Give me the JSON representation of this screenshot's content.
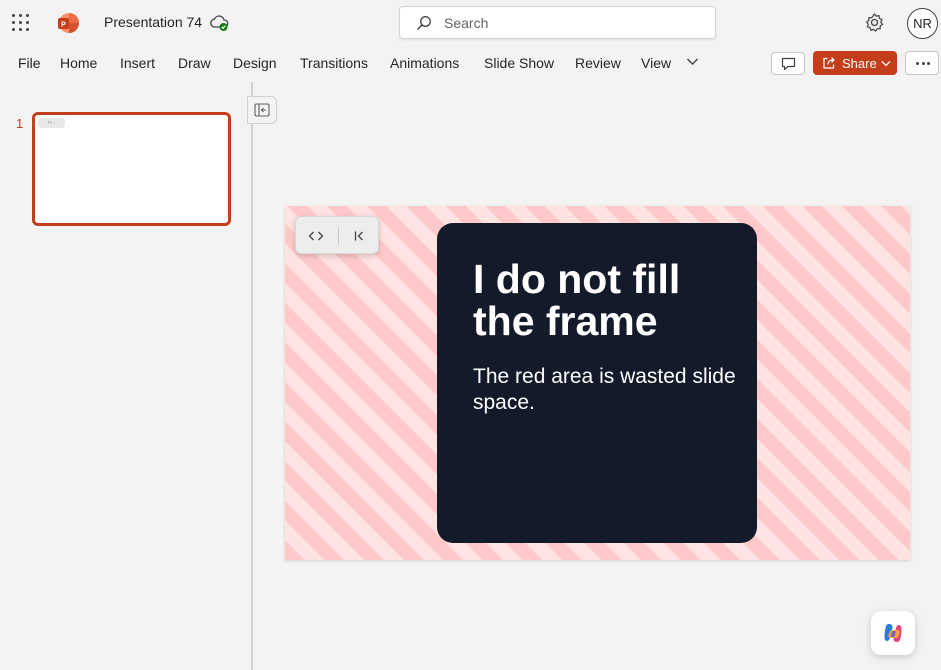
{
  "app": {
    "document_title": "Presentation 74",
    "user_initials": "NR"
  },
  "search": {
    "placeholder": "Search"
  },
  "ribbon": {
    "tabs": [
      "File",
      "Home",
      "Insert",
      "Draw",
      "Design",
      "Transitions",
      "Animations",
      "Slide Show",
      "Review",
      "View"
    ],
    "share_label": "Share"
  },
  "thumbnails": {
    "slide_number": "1"
  },
  "slide": {
    "title": "I do not fill the frame",
    "body": "The red area is wasted slide space."
  },
  "colors": {
    "accent": "#c43e1c",
    "card": "#131a2a",
    "stripe_dark": "#ffc9c9",
    "stripe_light": "#ffe2e2"
  },
  "icons": [
    "app-launcher-icon",
    "powerpoint-logo-icon",
    "cloud-saved-icon",
    "search-icon",
    "settings-gear-icon",
    "chevron-down-icon",
    "comment-icon",
    "share-icon",
    "more-options-icon",
    "collapse-pane-icon",
    "code-icon",
    "first-slide-icon",
    "copilot-icon"
  ]
}
